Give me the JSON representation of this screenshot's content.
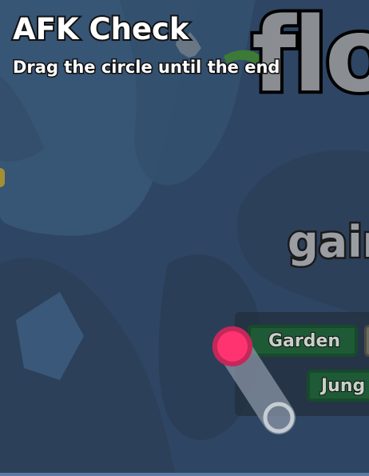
{
  "overlay": {
    "title": "AFK Check",
    "instruction": "Drag the circle until the end"
  },
  "game_logo": {
    "text": "flo"
  },
  "gain_label": {
    "text": "gain"
  },
  "biomes": {
    "items": [
      {
        "label": "Garden",
        "color": "#1e5a36"
      },
      {
        "label": "Jung",
        "color": "#1e5a36"
      }
    ]
  },
  "drag_circle": {
    "color": "#ff2f6d",
    "progress": 0
  },
  "colors": {
    "background": "#2e4563",
    "panel": "#23303e",
    "track": "#8a96a6"
  }
}
